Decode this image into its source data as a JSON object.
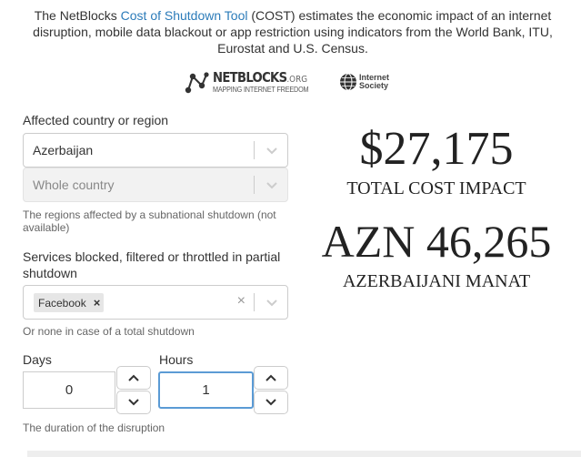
{
  "intro": {
    "prefix": "The NetBlocks ",
    "link": "Cost of Shutdown Tool",
    "suffix": " (COST) estimates the economic impact of an internet disruption, mobile data blackout or app restriction using indicators from the World Bank, ITU, Eurostat and U.S. Census."
  },
  "logos": {
    "netblocks_name": "NETBLOCKS",
    "netblocks_tld": ".ORG",
    "netblocks_tagline": "MAPPING INTERNET FREEDOM",
    "isoc_line1": "Internet",
    "isoc_line2": "Society"
  },
  "form": {
    "country_label": "Affected country or region",
    "country_value": "Azerbaijan",
    "region_value": "Whole country",
    "region_hint": "The regions affected by a subnational shutdown (not available)",
    "services_label": "Services blocked, filtered or throttled in partial shutdown",
    "services_selected": [
      "Facebook"
    ],
    "services_clear": "×",
    "services_hint": "Or none in case of a total shutdown",
    "days_label": "Days",
    "days_value": "0",
    "hours_label": "Hours",
    "hours_value": "1",
    "duration_hint": "The duration of the disruption"
  },
  "result": {
    "usd_amount": "$27,175",
    "usd_caption": "TOTAL COST IMPACT",
    "local_amount": "AZN 46,265",
    "local_caption": "AZERBAIJANI MANAT"
  },
  "icons": {
    "dropdown": "chevron-down-icon",
    "spin_up": "chevron-up-icon",
    "spin_down": "chevron-down-icon",
    "remove_tag": "close-icon"
  },
  "colors": {
    "link": "#2b7bb9",
    "focus_border": "#5b9bd5",
    "text": "#333333"
  }
}
